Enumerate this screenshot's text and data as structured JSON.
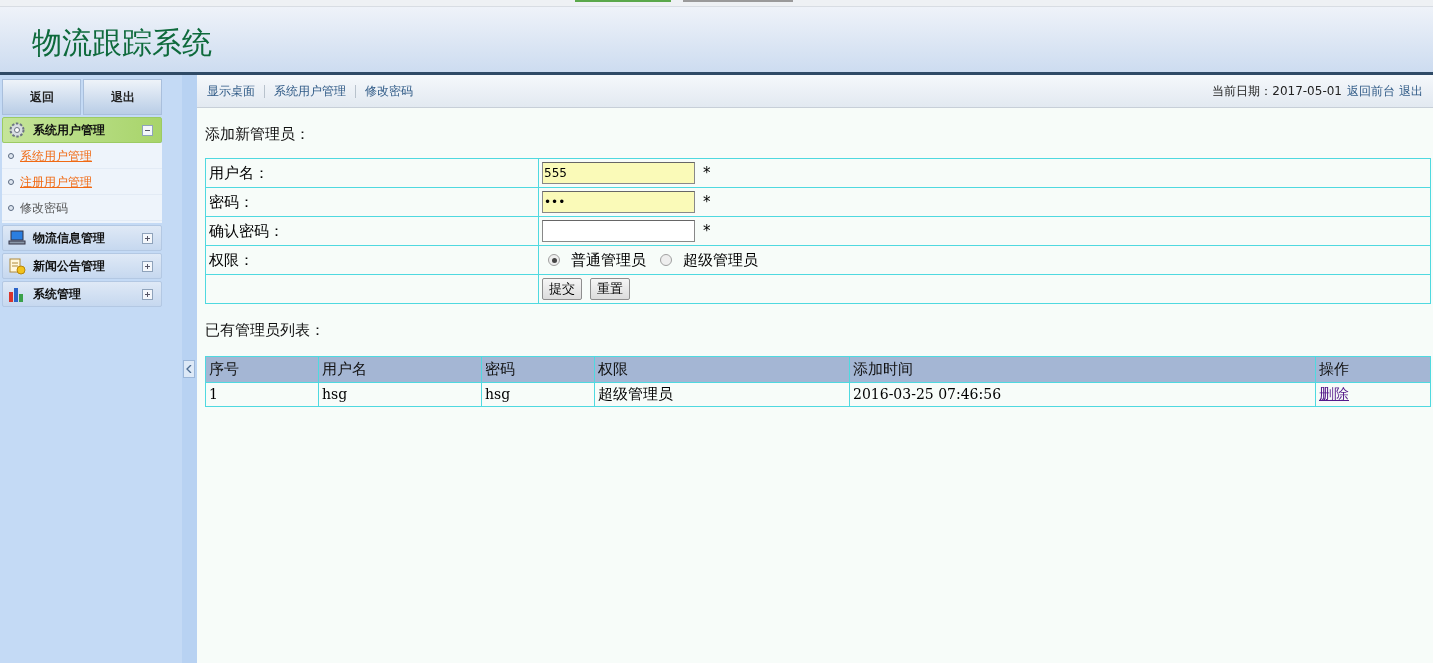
{
  "header": {
    "title": "物流跟踪系统"
  },
  "sidebar": {
    "buttons": [
      "返回",
      "退出"
    ],
    "menus": [
      {
        "label": "系统用户管理",
        "expanded": true,
        "items": [
          {
            "label": "系统用户管理",
            "kind": "link"
          },
          {
            "label": "注册用户管理",
            "kind": "link"
          },
          {
            "label": "修改密码",
            "kind": "text"
          }
        ]
      },
      {
        "label": "物流信息管理",
        "expanded": false
      },
      {
        "label": "新闻公告管理",
        "expanded": false
      },
      {
        "label": "系统管理",
        "expanded": false
      }
    ]
  },
  "breadcrumb": [
    "显示桌面",
    "系统用户管理",
    "修改密码"
  ],
  "topbar": {
    "date_text": "当前日期：2017-05-01",
    "links": [
      "返回前台",
      "退出"
    ]
  },
  "form": {
    "title": "添加新管理员：",
    "rows": [
      {
        "kind": "input",
        "label": "用户名：",
        "value": "555",
        "autofilled": true,
        "required": "*"
      },
      {
        "kind": "input",
        "label": "密码：",
        "value": "•••",
        "autofilled": true,
        "required": "*"
      },
      {
        "kind": "input",
        "label": "确认密码：",
        "value": "",
        "autofilled": false,
        "required": "*"
      },
      {
        "kind": "radio",
        "label": "权限：",
        "options": [
          {
            "label": "普通管理员",
            "selected": true
          },
          {
            "label": "超级管理员",
            "selected": false
          }
        ]
      },
      {
        "kind": "buttons",
        "label": "",
        "buttons": [
          "提交",
          "重置"
        ]
      }
    ]
  },
  "list": {
    "title": "已有管理员列表：",
    "columns": [
      "序号",
      "用户名",
      "密码",
      "权限",
      "添加时间",
      "操作"
    ],
    "rows": [
      {
        "cells": [
          "1",
          "hsg",
          "hsg",
          "超级管理员",
          "2016-03-25 07:46:56"
        ],
        "action": "删除"
      }
    ]
  }
}
